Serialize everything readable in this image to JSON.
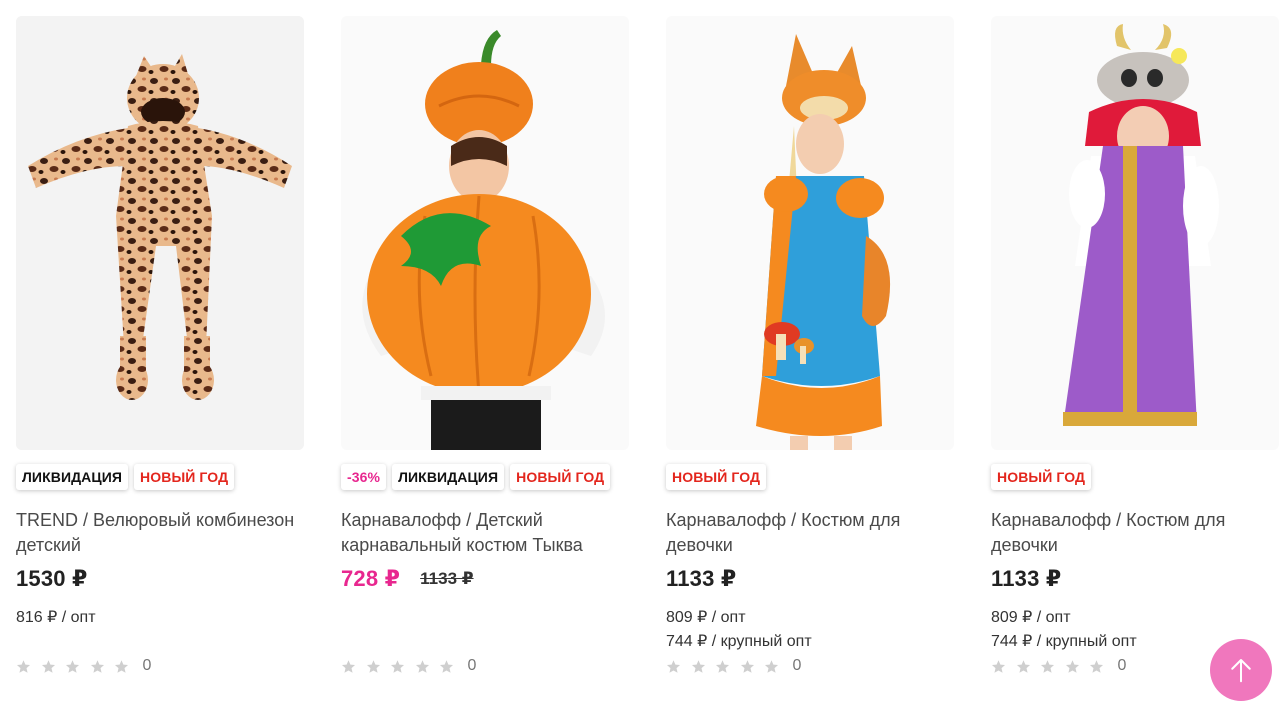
{
  "products": [
    {
      "badges": [
        {
          "label": "ЛИКВИДАЦИЯ",
          "kind": "liq"
        },
        {
          "label": "НОВЫЙ ГОД",
          "kind": "ny"
        }
      ],
      "title": "TREND / Велюровый комбинезон детский",
      "price": "1530 ₽",
      "old_price": "",
      "opt": "816 ₽ / опт",
      "opt_large": "",
      "rating_count": "0",
      "image": "leopard-print-baby-jumpsuit"
    },
    {
      "badges": [
        {
          "label": "-36%",
          "kind": "disc"
        },
        {
          "label": "ЛИКВИДАЦИЯ",
          "kind": "liq"
        },
        {
          "label": "НОВЫЙ ГОД",
          "kind": "ny"
        }
      ],
      "title": "Карнавалофф / Детский карнавальный костюм Тыква",
      "price": "728 ₽",
      "old_price": "1133 ₽",
      "opt": "",
      "opt_large": "",
      "rating_count": "0",
      "image": "pumpkin-costume"
    },
    {
      "badges": [
        {
          "label": "НОВЫЙ ГОД",
          "kind": "ny"
        }
      ],
      "title": "Карнавалофф / Костюм для девочки",
      "price": "1133 ₽",
      "old_price": "",
      "opt": "809 ₽ / опт",
      "opt_large": "744 ₽ / крупный опт",
      "rating_count": "0",
      "image": "squirrel-costume"
    },
    {
      "badges": [
        {
          "label": "НОВЫЙ ГОД",
          "kind": "ny"
        }
      ],
      "title": "Карнавалофф / Костюм для девочки",
      "price": "1133 ₽",
      "old_price": "",
      "opt": "809 ₽ / опт",
      "opt_large": "744 ₽ / крупный опт",
      "rating_count": "0",
      "image": "goat-costume"
    }
  ],
  "colors": {
    "sale_pink": "#e8278f",
    "new_year_red": "#e3261d",
    "scroll_button": "#f077bd",
    "star_empty": "#cfcfcf"
  },
  "scroll_top_icon": "arrow-up-icon"
}
